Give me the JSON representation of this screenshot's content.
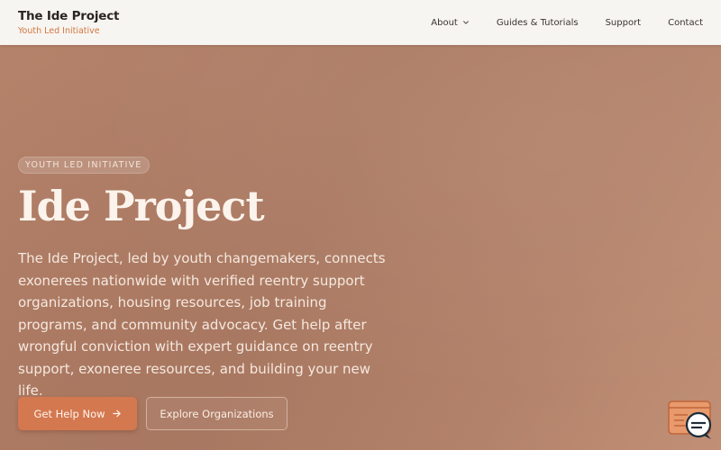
{
  "header": {
    "brand_title": "The Ide Project",
    "brand_tagline": "Youth Led Initiative",
    "nav": [
      {
        "label": "About",
        "has_dropdown": true
      },
      {
        "label": "Guides & Tutorials"
      },
      {
        "label": "Support"
      },
      {
        "label": "Contact"
      }
    ]
  },
  "hero": {
    "eyebrow": "YOUTH LED INITIATIVE",
    "title": "Ide Project",
    "description": "The Ide Project, led by youth changemakers, connects exonerees nationwide with verified reentry support organizations, housing resources, job training programs, and community advocacy. Get help after wrongful conviction with expert guidance on reentry support, exoneree resources, and building your new life.",
    "primary_button": "Get Help Now",
    "secondary_button": "Explore Organizations"
  },
  "icons": {
    "dropdown": "chevron-down-icon",
    "cta_arrow": "arrow-right-icon",
    "chat": "chat-support-icon"
  },
  "colors": {
    "accent": "#d4784f",
    "tagline": "#d2763f",
    "header_bg": "#f7f5f2",
    "hero_bg": "#b07e65"
  }
}
